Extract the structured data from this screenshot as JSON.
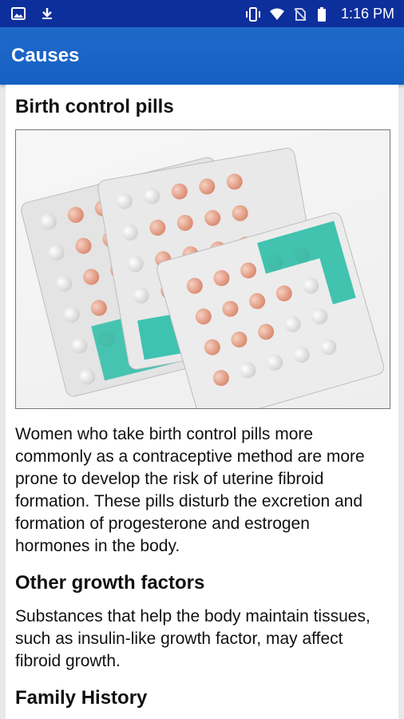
{
  "status_bar": {
    "time": "1:16 PM",
    "icons": [
      "image-icon",
      "download-icon",
      "vibrate-icon",
      "wifi-icon",
      "no-sim-icon",
      "battery-icon"
    ]
  },
  "app_bar": {
    "title": "Causes"
  },
  "sections": [
    {
      "heading": "Birth control pills",
      "image": "birth-control-pill-packs",
      "text": "Women who take birth control pills more commonly as a contraceptive method are more prone to develop the risk of uterine fibroid formation. These pills disturb the excretion and formation of progesterone and estrogen hormones in the body."
    },
    {
      "heading": "Other growth factors",
      "text": "Substances that help the body maintain tissues, such as insulin-like growth factor, may affect fibroid growth."
    },
    {
      "heading": "Family History"
    }
  ],
  "colors": {
    "status_bar": "#0d2f9c",
    "app_bar": "#1f69c9",
    "pill_pink": "#e8b09a",
    "pill_white": "#f2f2f2",
    "pack_teal": "#2fbfaa"
  }
}
